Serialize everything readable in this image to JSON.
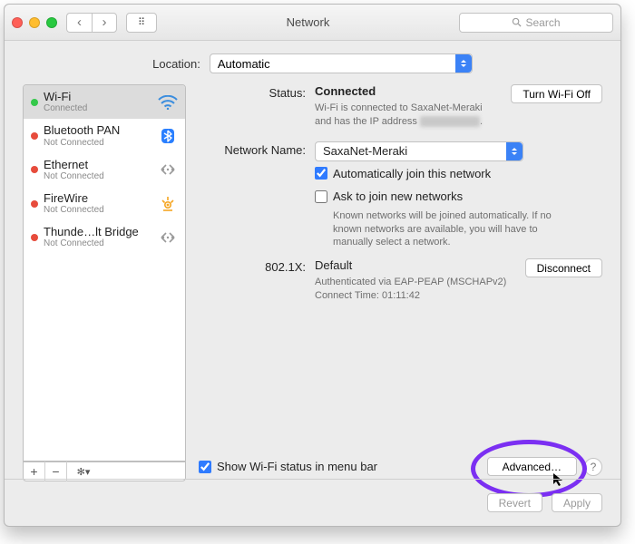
{
  "window": {
    "title": "Network",
    "search_placeholder": "Search"
  },
  "location": {
    "label": "Location:",
    "value": "Automatic"
  },
  "sidebar": {
    "items": [
      {
        "name": "Wi-Fi",
        "status": "Connected",
        "dot": "green2",
        "selected": true,
        "icon": "wifi"
      },
      {
        "name": "Bluetooth PAN",
        "status": "Not Connected",
        "dot": "red2",
        "selected": false,
        "icon": "bluetooth"
      },
      {
        "name": "Ethernet",
        "status": "Not Connected",
        "dot": "red2",
        "selected": false,
        "icon": "ethernet"
      },
      {
        "name": "FireWire",
        "status": "Not Connected",
        "dot": "red2",
        "selected": false,
        "icon": "firewire"
      },
      {
        "name": "Thunde…lt Bridge",
        "status": "Not Connected",
        "dot": "red2",
        "selected": false,
        "icon": "ethernet"
      }
    ],
    "toolbar": {
      "add": "+",
      "remove": "−",
      "gear": "✻▾"
    }
  },
  "main": {
    "status_label": "Status:",
    "status_value": "Connected",
    "turn_off": "Turn Wi-Fi Off",
    "status_desc_pre": "Wi-Fi is connected to SaxaNet-Meraki and has the IP address ",
    "status_desc_post": ".",
    "netname_label": "Network Name:",
    "netname_value": "SaxaNet-Meraki",
    "auto_join": "Automatically join this network",
    "ask_join": "Ask to join new networks",
    "ask_desc": "Known networks will be joined automatically. If no known networks are available, you will have to manually select a network.",
    "dot1x_label": "802.1X:",
    "dot1x_value": "Default",
    "disconnect": "Disconnect",
    "dot1x_auth": "Authenticated via EAP-PEAP (MSCHAPv2)",
    "dot1x_time": "Connect Time: 01:11:42",
    "show_status": "Show Wi-Fi status in menu bar",
    "advanced": "Advanced…"
  },
  "footer": {
    "revert": "Revert",
    "apply": "Apply"
  },
  "colors": {
    "accent": "#2f7bff",
    "highlight_ring": "#7b2ff2"
  }
}
